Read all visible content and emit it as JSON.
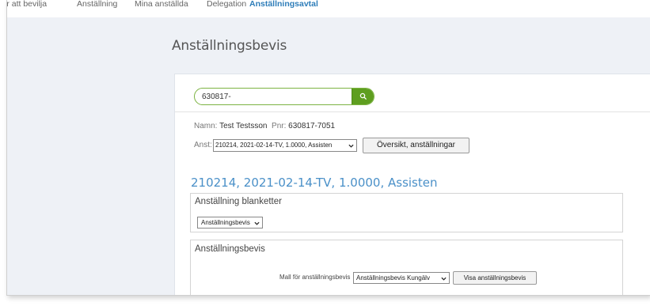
{
  "topnav": {
    "items": [
      {
        "label": "ir att bevilja",
        "active": false
      },
      {
        "label": "Anställning",
        "active": false
      },
      {
        "label": "Mina anställda",
        "active": false
      },
      {
        "label": "Delegation",
        "active": false
      },
      {
        "label": "Anställningsavtal",
        "active": true
      }
    ]
  },
  "page": {
    "title": "Anställningsbevis"
  },
  "search": {
    "value": "630817-",
    "icon": "search-icon",
    "accent_color": "#5e9e1f"
  },
  "person": {
    "name_label": "Namn:",
    "name_value": "Test Testsson",
    "pnr_label": "Pnr:",
    "pnr_value": "630817-7051"
  },
  "employment": {
    "label": "Anst:",
    "selected": "210214, 2021-02-14-TV, 1.0000, Assisten",
    "overview_button": "Översikt, anställningar",
    "heading": "210214, 2021-02-14-TV, 1.0000, Assisten",
    "heading_color": "#4a90c8"
  },
  "blanketter": {
    "title": "Anställning blanketter",
    "selected": "Anställningsbevis"
  },
  "bevis": {
    "title": "Anställningsbevis",
    "template_label": "Mall för anställningsbevis",
    "template_selected": "Anställningsbevis Kungälv",
    "show_button": "Visa anställningsbevis"
  }
}
